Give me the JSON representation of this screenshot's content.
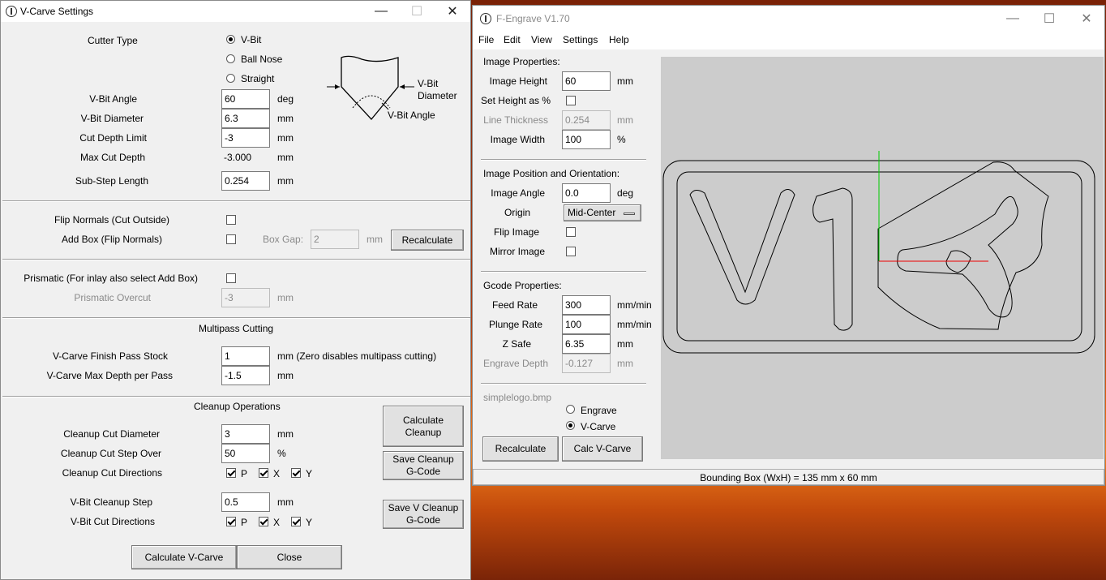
{
  "vcarve": {
    "title": "V-Carve Settings",
    "cutter_type_label": "Cutter Type",
    "cutter_options": [
      "V-Bit",
      "Ball Nose",
      "Straight"
    ],
    "diagram": {
      "diameter_label_1": "V-Bit",
      "diameter_label_2": "Diameter",
      "angle_label": "V-Bit Angle"
    },
    "vbit_angle": {
      "label": "V-Bit Angle",
      "value": "60",
      "unit": "deg"
    },
    "vbit_diameter": {
      "label": "V-Bit Diameter",
      "value": "6.3",
      "unit": "mm"
    },
    "cut_depth_limit": {
      "label": "Cut Depth Limit",
      "value": "-3",
      "unit": "mm"
    },
    "max_cut_depth": {
      "label": "Max Cut Depth",
      "value": "-3.000",
      "unit": "mm"
    },
    "sub_step": {
      "label": "Sub-Step Length",
      "value": "0.254",
      "unit": "mm"
    },
    "flip_normals_label": "Flip Normals (Cut Outside)",
    "add_box_label": "Add Box (Flip Normals)",
    "box_gap": {
      "label": "Box Gap:",
      "value": "2",
      "unit": "mm"
    },
    "recalculate_label": "Recalculate",
    "prismatic_label": "Prismatic (For inlay also select Add Box)",
    "prismatic_overcut": {
      "label": "Prismatic Overcut",
      "value": "-3",
      "unit": "mm"
    },
    "multipass_heading": "Multipass Cutting",
    "finish_pass": {
      "label": "V-Carve Finish Pass Stock",
      "value": "1",
      "unit": "mm (Zero disables multipass cutting)"
    },
    "max_depth_pass": {
      "label": "V-Carve Max Depth per Pass",
      "value": "-1.5",
      "unit": "mm"
    },
    "cleanup_heading": "Cleanup Operations",
    "cleanup_diameter": {
      "label": "Cleanup Cut Diameter",
      "value": "3",
      "unit": "mm"
    },
    "cleanup_stepover": {
      "label": "Cleanup Cut Step Over",
      "value": "50",
      "unit": "%"
    },
    "cleanup_directions_label": "Cleanup Cut Directions",
    "vbit_cleanup_step": {
      "label": "V-Bit Cleanup Step",
      "value": "0.5",
      "unit": "mm"
    },
    "vbit_directions_label": "V-Bit Cut Directions",
    "dir_labels": [
      "P",
      "X",
      "Y"
    ],
    "calc_cleanup_label": "Calculate\nCleanup",
    "save_cleanup_label": "Save Cleanup\nG-Code",
    "save_v_cleanup_label": "Save V Cleanup\nG-Code",
    "calc_vcarve_label": "Calculate V-Carve",
    "close_label": "Close"
  },
  "fengrave": {
    "title": "F-Engrave V1.70",
    "menu": [
      "File",
      "Edit",
      "View",
      "Settings",
      "Help"
    ],
    "image_props_heading": "Image Properties:",
    "image_height": {
      "label": "Image Height",
      "value": "60",
      "unit": "mm"
    },
    "set_height_label": "Set Height as %",
    "line_thickness": {
      "label": "Line Thickness",
      "value": "0.254",
      "unit": "mm"
    },
    "image_width": {
      "label": "Image Width",
      "value": "100",
      "unit": "%"
    },
    "position_heading": "Image Position and Orientation:",
    "image_angle": {
      "label": "Image Angle",
      "value": "0.0",
      "unit": "deg"
    },
    "origin": {
      "label": "Origin",
      "value": "Mid-Center"
    },
    "flip_image_label": "Flip Image",
    "mirror_image_label": "Mirror Image",
    "gcode_heading": "Gcode Properties:",
    "feed_rate": {
      "label": "Feed Rate",
      "value": "300",
      "unit": "mm/min"
    },
    "plunge_rate": {
      "label": "Plunge Rate",
      "value": "100",
      "unit": "mm/min"
    },
    "z_safe": {
      "label": "Z Safe",
      "value": "6.35",
      "unit": "mm"
    },
    "engrave_depth": {
      "label": "Engrave Depth",
      "value": "-0.127",
      "unit": "mm"
    },
    "filename": "simplelogo.bmp",
    "mode_engrave": "Engrave",
    "mode_vcarve": "V-Carve",
    "recalculate_label": "Recalculate",
    "calc_vcarve_label": "Calc V-Carve",
    "status": "Bounding Box (WxH) = 135 mm  x 60 mm"
  }
}
